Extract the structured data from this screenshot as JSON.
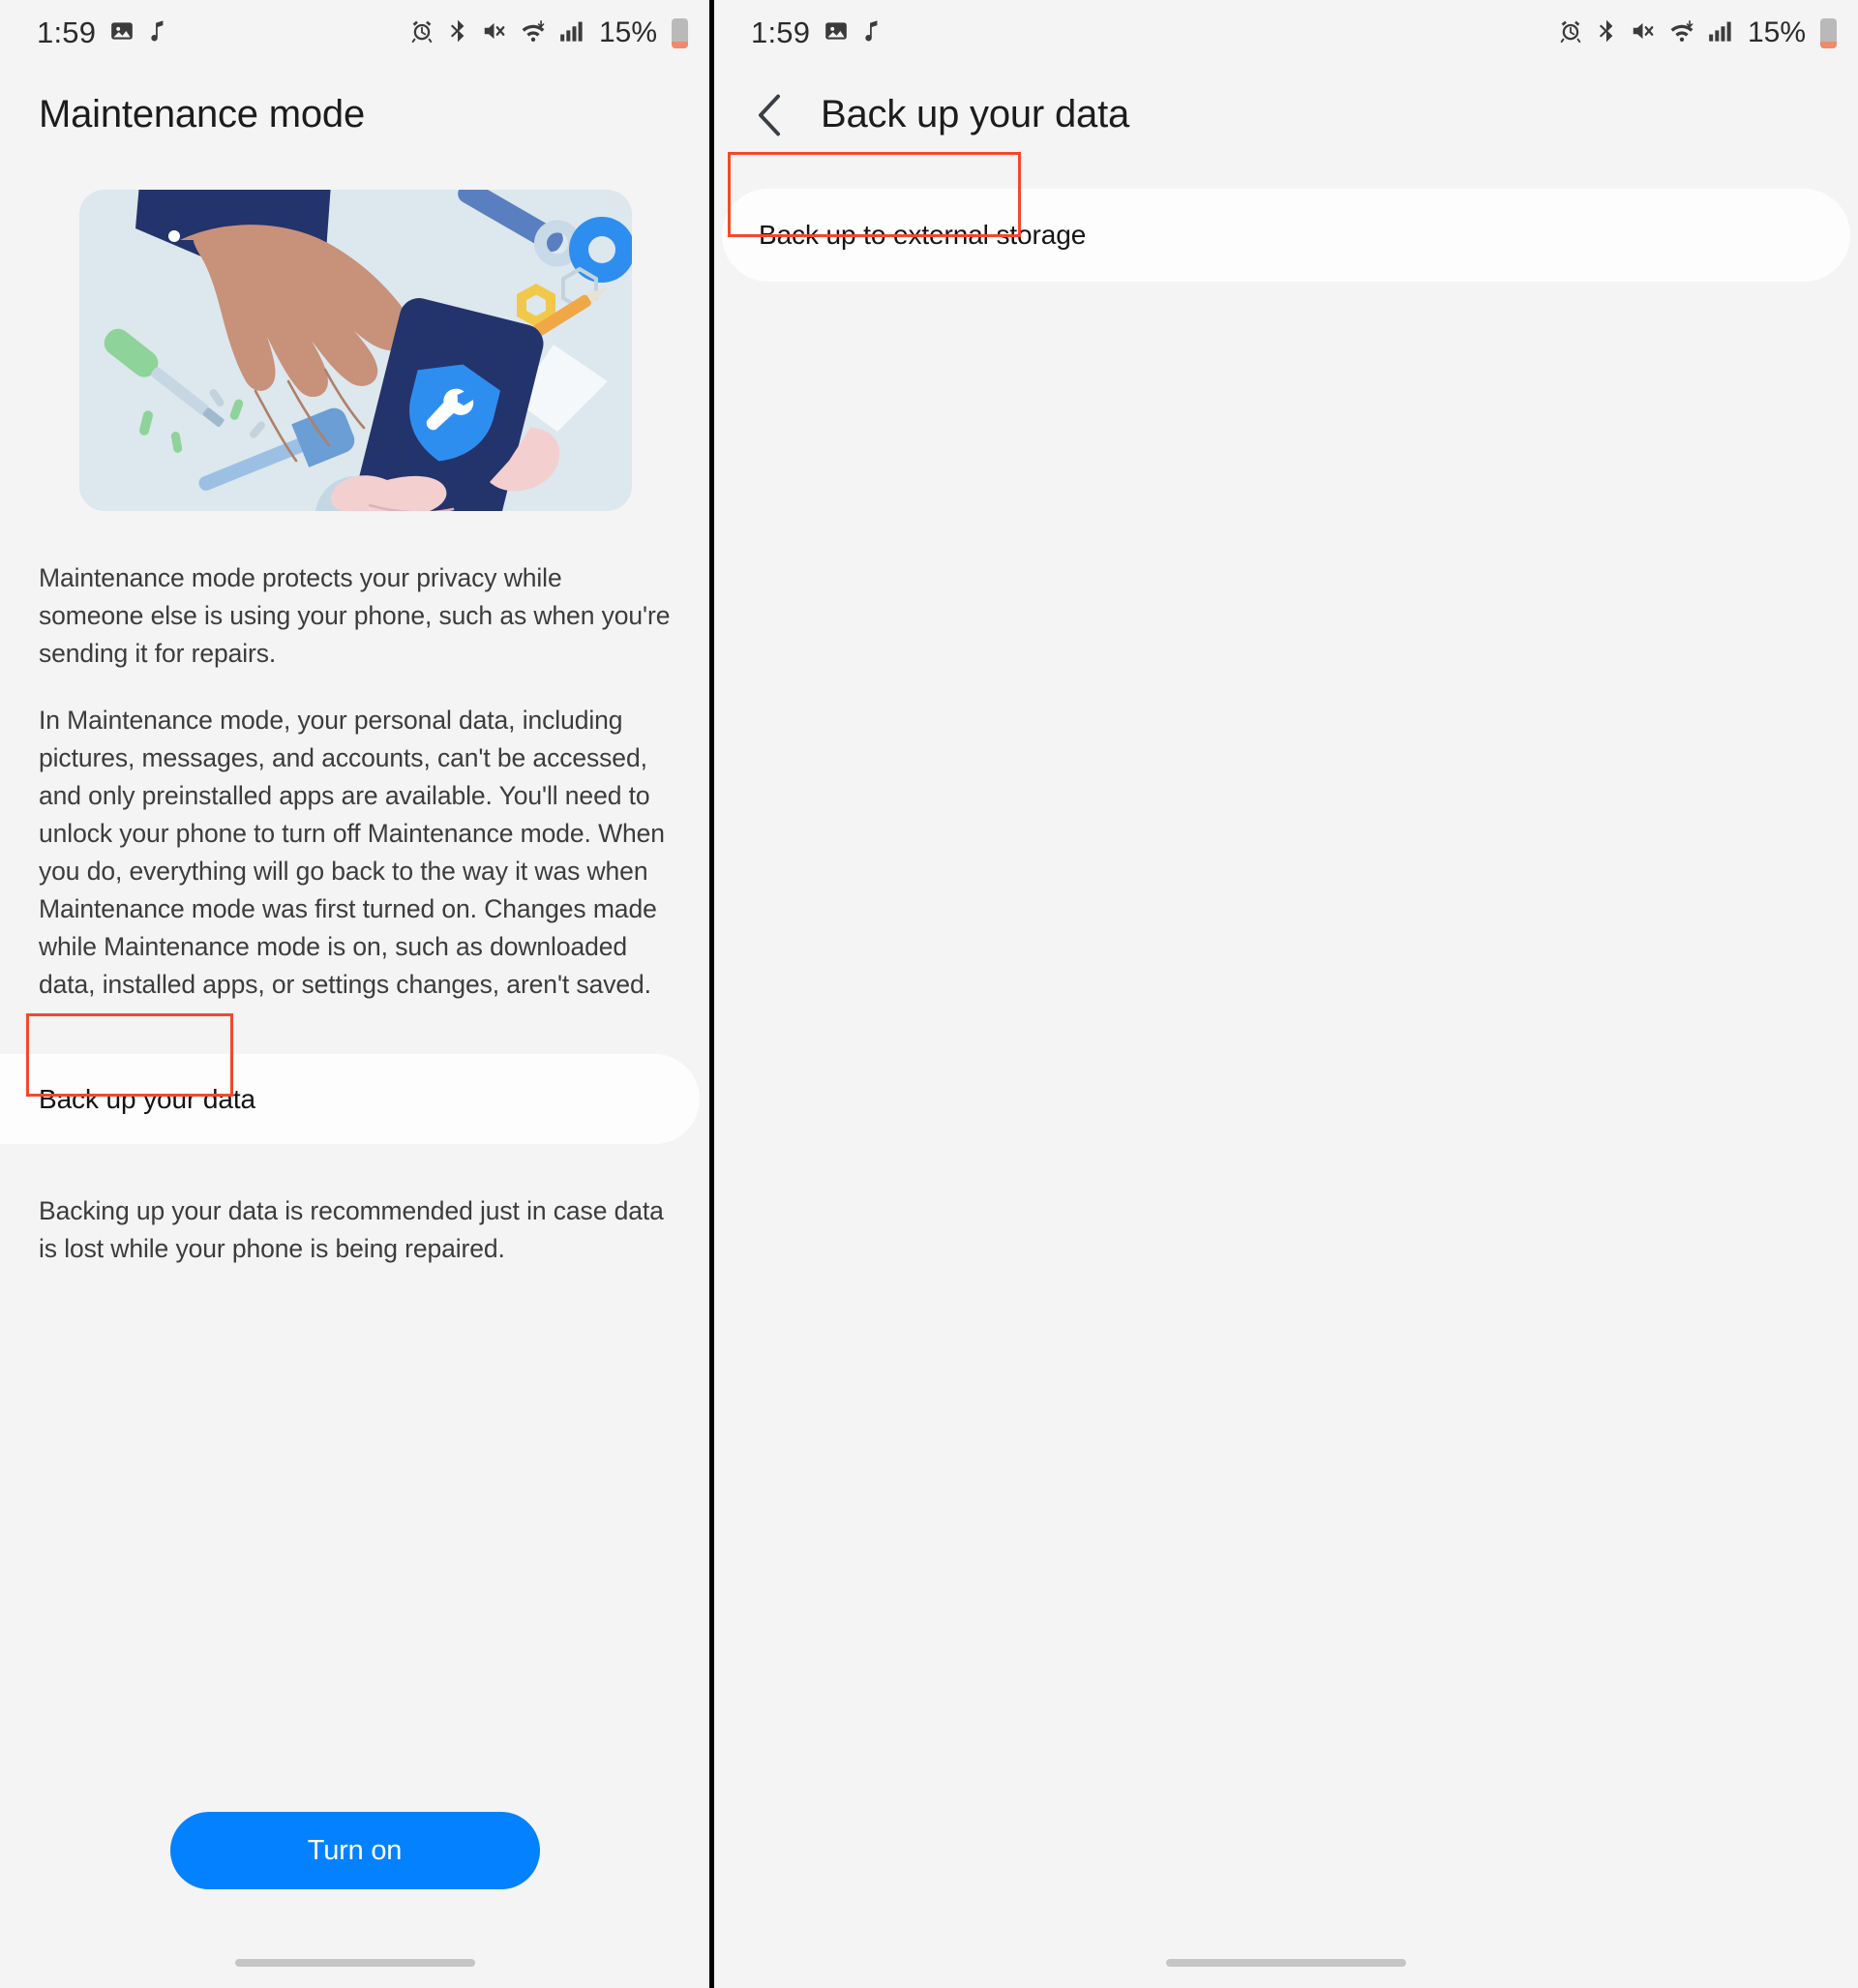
{
  "status_bar": {
    "time": "1:59",
    "battery_percent": "15%",
    "left_icons": [
      "photo-icon",
      "music-note-icon"
    ],
    "right_icons": [
      "alarm-icon",
      "bluetooth-icon",
      "mute-icon",
      "wifi-icon",
      "signal-icon"
    ],
    "battery_icon": "battery-icon"
  },
  "left_screen": {
    "title": "Maintenance mode",
    "illustration_alt": "hands-holding-phone-with-repair-shield-illustration",
    "paragraphs": [
      "Maintenance mode protects your privacy while someone else is using your phone, such as when you're sending it for repairs.",
      "In Maintenance mode, your personal data, including pictures, messages, and accounts, can't be accessed, and only preinstalled apps are available. You'll need to unlock your phone to turn off Maintenance mode. When you do, everything will go back to the way it was when Maintenance mode was first turned on. Changes made while Maintenance mode is on, such as downloaded data, installed apps, or settings changes, aren't saved."
    ],
    "backup_row_label": "Back up your data",
    "footnote": "Backing up your data is recommended just in case data is lost while your phone is being repaired.",
    "primary_button": "Turn on"
  },
  "right_screen": {
    "back_icon": "chevron-left-icon",
    "title": "Back up your data",
    "external_storage_row_label": "Back up to external storage"
  },
  "colors": {
    "accent_blue": "#0381fe",
    "highlight_red": "#f4492a",
    "page_background": "#f4f4f4",
    "card_background": "#fdfdfd",
    "illustration_background": "#dde7ee"
  }
}
